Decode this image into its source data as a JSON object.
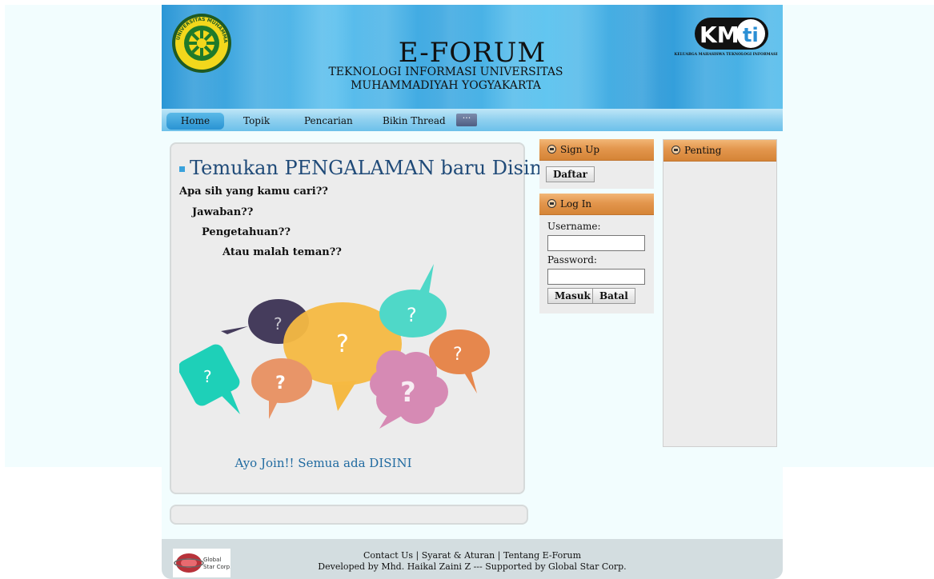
{
  "header": {
    "title": "E-FORUM",
    "subtitle": "TEKNOLOGI INFORMASI UNIVERSITAS MUHAMMADIYAH YOGYAKARTA",
    "umy_logo_text": "UNIVERSITAS MUHAMMADIYAH YOGYAKARTA",
    "kmti_logo_text": "KMti",
    "kmti_caption": "KELUARGA MAHASISWA TEKNOLOGI INFORMASI"
  },
  "nav": {
    "items": [
      {
        "label": "Home",
        "active": true
      },
      {
        "label": "Topik"
      },
      {
        "label": "Pencarian"
      },
      {
        "label": "Bikin Thread"
      }
    ],
    "more_label": "···"
  },
  "main": {
    "headline": "Temukan PENGALAMAN baru Disini !!!",
    "questions": [
      "Apa sih yang kamu cari??",
      "Jawaban??",
      "Pengetahuan??",
      "Atau malah teman??"
    ],
    "join_text": "Ayo Join!! Semua ada DISINI",
    "bubble_glyphs": [
      "?",
      "?",
      "?",
      "?",
      "?",
      "?",
      "?"
    ]
  },
  "signup": {
    "title": "Sign Up",
    "button": "Daftar"
  },
  "login": {
    "title": "Log In",
    "username_label": "Username:",
    "username_value": "",
    "password_label": "Password:",
    "password_value": "",
    "submit": "Masuk",
    "cancel": "Batal"
  },
  "penting": {
    "title": "Penting"
  },
  "footer": {
    "links": [
      "Contact Us",
      "Syarat & Aturan",
      "Tentang E-Forum"
    ],
    "separator": "|",
    "credit": "Developed by Mhd. Haikal Zaini Z --- Supported by Global Star Corp.",
    "logo_text": "Global Star Corp."
  },
  "colors": {
    "header_blue": "#3aa6e0",
    "box_header_orange": "#e3964d",
    "headline_blue": "#1f4a78",
    "join_blue": "#1f6aa0"
  }
}
